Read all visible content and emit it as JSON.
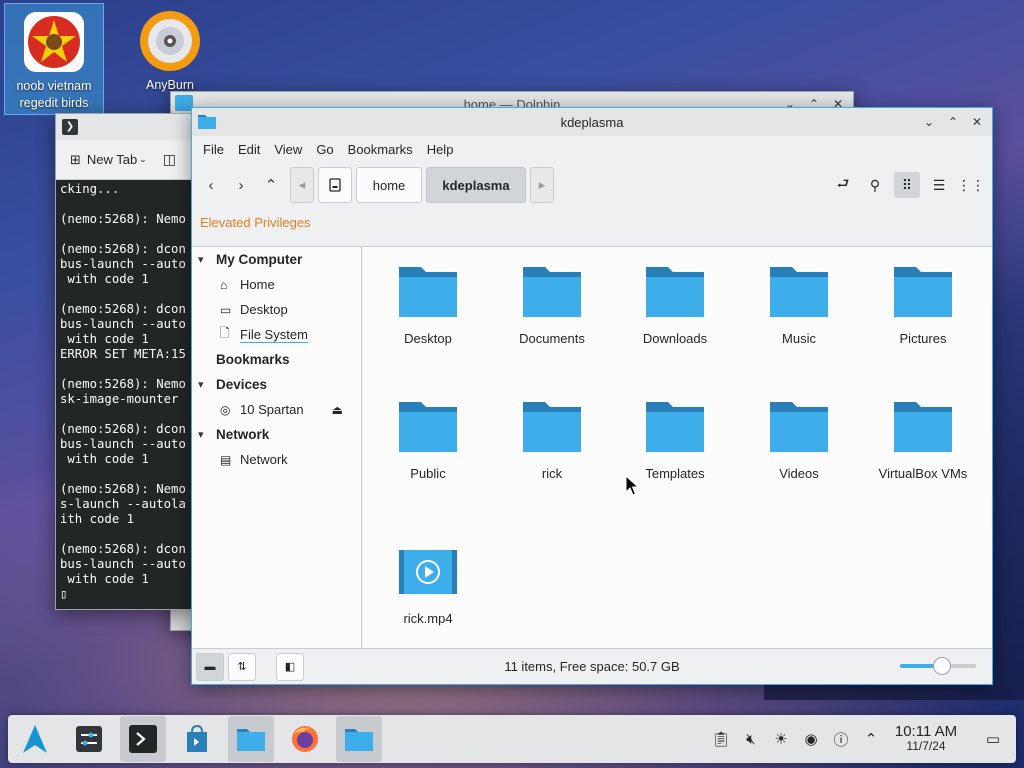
{
  "desktop": {
    "icons": [
      {
        "label_line1": "noob vietnam",
        "label_line2": "regedit birds"
      },
      {
        "label_line1": "AnyBurn",
        "label_line2": ""
      }
    ]
  },
  "background_window": {
    "title": "home — Dolphin"
  },
  "terminal": {
    "new_tab_label": "New Tab",
    "lines": "cking...\n\n(nemo:5268): Nemo\n\n(nemo:5268): dcon\nbus-launch --auto\n with code 1\n\n(nemo:5268): dcon\nbus-launch --auto\n with code 1\nERROR SET META:15\n\n(nemo:5268): Nemo\nsk-image-mounter\n\n(nemo:5268): dcon\nbus-launch --auto\n with code 1\n\n(nemo:5268): Nemo\ns-launch --autola\nith code 1\n\n(nemo:5268): dcon\nbus-launch --auto\n with code 1\n▯"
  },
  "dolphin": {
    "title": "kdeplasma",
    "menu": [
      "File",
      "Edit",
      "View",
      "Go",
      "Bookmarks",
      "Help"
    ],
    "breadcrumbs": [
      "home",
      "kdeplasma"
    ],
    "elevated_label": "Elevated Privileges",
    "places": {
      "my_computer": "My Computer",
      "home": "Home",
      "desktop": "Desktop",
      "file_system": "File System",
      "bookmarks": "Bookmarks",
      "devices": "Devices",
      "spartan": "10 Spartan",
      "network_hdr": "Network",
      "network": "Network"
    },
    "files": [
      "Desktop",
      "Documents",
      "Downloads",
      "Music",
      "Pictures",
      "Public",
      "rick",
      "Templates",
      "Videos",
      "VirtualBox VMs",
      "rick.mp4"
    ],
    "status": "11 items, Free space: 50.7 GB",
    "zoom_level": 0.55
  },
  "taskbar": {
    "time": "10:11 AM",
    "date": "11/7/24"
  },
  "colors": {
    "folder": "#3daee9",
    "folder_dark": "#2980b9",
    "accent": "#3daee9",
    "elevated": "#e67e22"
  }
}
